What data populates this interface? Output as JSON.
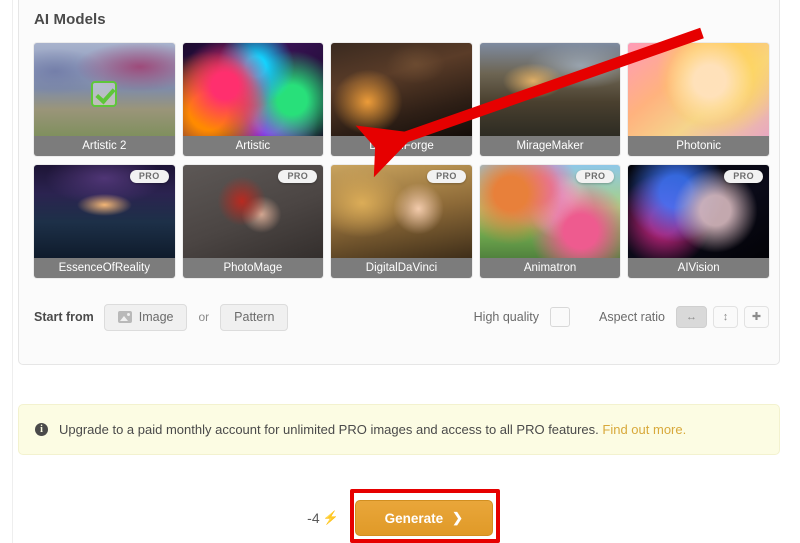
{
  "panel": {
    "title": "AI Models",
    "models_row1": [
      {
        "name": "Artistic 2",
        "art": "art-artistic2",
        "pro": false,
        "selected": true
      },
      {
        "name": "Artistic",
        "art": "art-artistic",
        "pro": false,
        "selected": false
      },
      {
        "name": "DreamForge",
        "art": "art-dreamforge",
        "pro": false,
        "selected": false
      },
      {
        "name": "MirageMaker",
        "art": "art-miragemaker",
        "pro": false,
        "selected": false
      },
      {
        "name": "Photonic",
        "art": "art-photonic",
        "pro": false,
        "selected": false
      }
    ],
    "models_row2": [
      {
        "name": "EssenceOfReality",
        "art": "art-essence",
        "pro": true,
        "selected": false
      },
      {
        "name": "PhotoMage",
        "art": "art-photomage",
        "pro": true,
        "selected": false
      },
      {
        "name": "DigitalDaVinci",
        "art": "art-davinci",
        "pro": true,
        "selected": false
      },
      {
        "name": "Animatron",
        "art": "art-animatron",
        "pro": true,
        "selected": false
      },
      {
        "name": "AIVision",
        "art": "art-aivision",
        "pro": true,
        "selected": false
      }
    ],
    "pro_badge_label": "PRO"
  },
  "options": {
    "start_from_label": "Start from",
    "image_button": "Image",
    "or_text": "or",
    "pattern_button": "Pattern",
    "high_quality_label": "High quality",
    "high_quality_checked": false,
    "aspect_ratio_label": "Aspect ratio",
    "aspect_ratios": [
      {
        "icon": "↔",
        "name": "landscape",
        "active": true
      },
      {
        "icon": "↕",
        "name": "portrait",
        "active": false
      },
      {
        "icon": "✚",
        "name": "square",
        "active": false
      }
    ]
  },
  "notice": {
    "icon": "i",
    "text": "Upgrade to a paid monthly account for unlimited PRO images and access to all PRO features.",
    "link_text": "Find out more."
  },
  "generate": {
    "credits": "-4",
    "bolt": "⚡",
    "label": "Generate",
    "chevron": "❯"
  },
  "annotations": {
    "arrow_color": "#e60000",
    "highlight_color": "#e60000"
  }
}
